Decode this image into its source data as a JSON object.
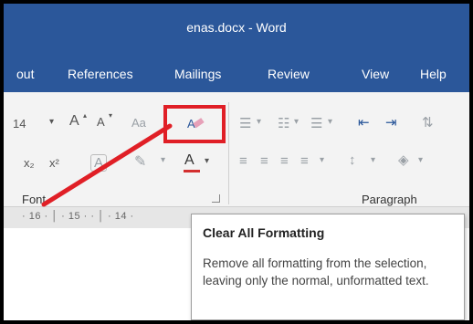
{
  "window": {
    "title": "enas.docx  -  Word"
  },
  "tabs": [
    {
      "label": "out"
    },
    {
      "label": "References"
    },
    {
      "label": "Mailings"
    },
    {
      "label": "Review"
    },
    {
      "label": "View"
    },
    {
      "label": "Help"
    }
  ],
  "font_group": {
    "font_size": "14",
    "grow_font": "A",
    "shrink_font": "A",
    "change_case": "Aa",
    "subscript": "x₂",
    "superscript": "x²",
    "text_effects": "A",
    "font_color": "A",
    "label": "Font"
  },
  "paragraph_group": {
    "label": "Paragraph"
  },
  "ruler": {
    "text": "· 16 · │ · 15 · · │ · 14 ·"
  },
  "tooltip": {
    "title": "Clear All Formatting",
    "description": "Remove all formatting from the selection, leaving only the normal, unformatted text."
  },
  "colors": {
    "ribbon_blue": "#2b579a",
    "annotation_red": "#e01f26"
  }
}
